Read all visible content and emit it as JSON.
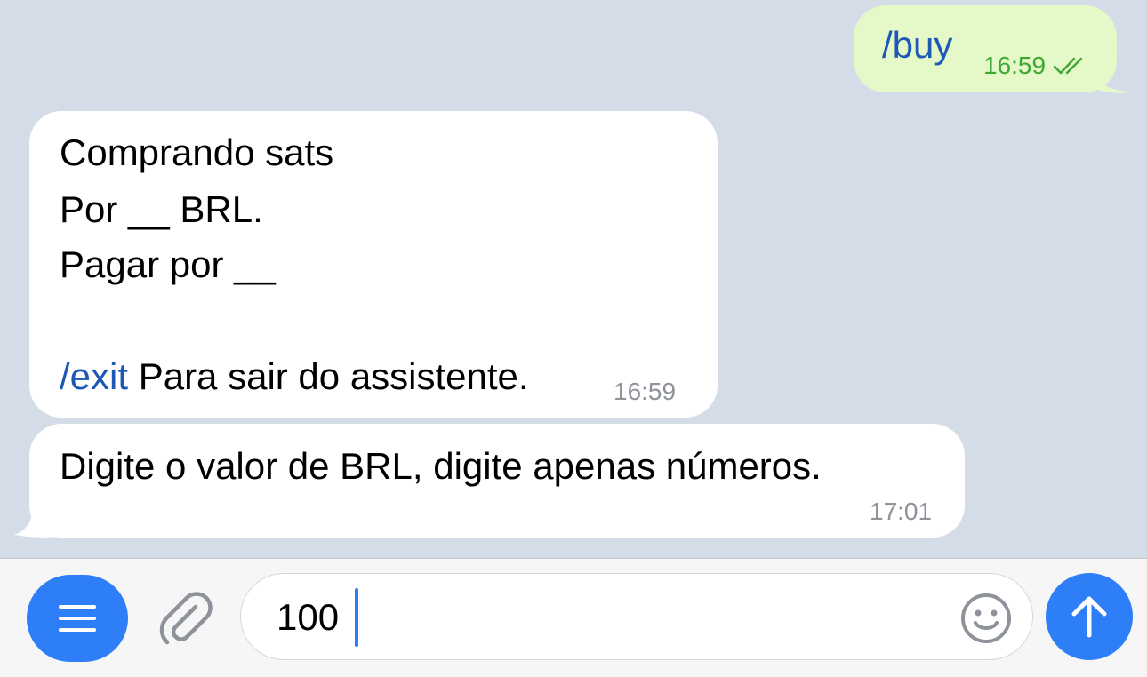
{
  "messages": {
    "outgoing": {
      "text": "/buy",
      "time": "16:59"
    },
    "incoming_1": {
      "line1": "Comprando sats",
      "line2": "Por __ BRL.",
      "line3": "Pagar por __",
      "command": "/exit",
      "command_suffix": " Para sair do assistente.",
      "time": "16:59"
    },
    "incoming_2": {
      "text": "Digite o valor de BRL, digite apenas números.",
      "time": "17:01"
    }
  },
  "composer": {
    "value": "100"
  },
  "icons": {
    "menu": "menu-icon",
    "attach": "paperclip-icon",
    "emoji": "emoji-icon",
    "send": "arrow-up-icon",
    "read_status": "double-check-icon"
  },
  "colors": {
    "accent": "#2d7ef7",
    "link": "#1e58b5",
    "outgoing_bubble": "#e5f8c8",
    "read_check": "#3ea833",
    "chat_background": "#d4dce8"
  }
}
